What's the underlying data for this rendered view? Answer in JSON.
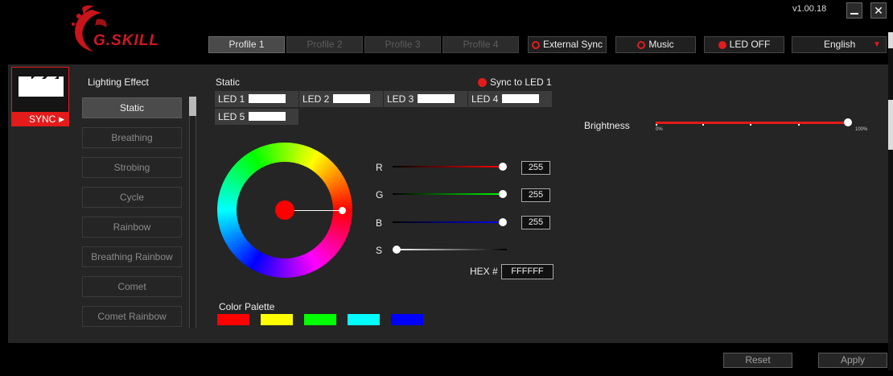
{
  "header": {
    "logo_text": "G.SKILL",
    "version": "v1.00.18",
    "minimize_icon": "minimize-icon",
    "close_icon": "close-icon"
  },
  "profiles": [
    "Profile 1",
    "Profile 2",
    "Profile 3",
    "Profile 4"
  ],
  "toolbar": {
    "external_sync": "External Sync",
    "music": "Music",
    "led_off": "LED OFF",
    "language": "English"
  },
  "sync": {
    "label": "SYNC"
  },
  "effects": {
    "title": "Lighting Effect",
    "items": [
      "Static",
      "Breathing",
      "Strobing",
      "Cycle",
      "Rainbow",
      "Breathing Rainbow",
      "Comet",
      "Comet Rainbow"
    ],
    "selected": "Static"
  },
  "static": {
    "title": "Static",
    "sync_to_led": "Sync to LED 1",
    "leds": [
      "LED 1",
      "LED 2",
      "LED 3",
      "LED 4",
      "LED 5"
    ],
    "led_color": "#FFFFFF"
  },
  "color": {
    "r_label": "R",
    "g_label": "G",
    "b_label": "B",
    "s_label": "S",
    "r": "255",
    "g": "255",
    "b": "255",
    "saturation": 0,
    "hex_label": "HEX #",
    "hex": "FFFFFF",
    "selected_color": "#ff0000"
  },
  "palette": {
    "title": "Color Palette",
    "colors": [
      "#ff0000",
      "#ffff00",
      "#00ff00",
      "#00ffff",
      "#0000ff"
    ]
  },
  "brightness": {
    "label": "Brightness",
    "min_label": "0%",
    "max_label": "100%",
    "value_percent": 100
  },
  "footer": {
    "reset": "Reset",
    "apply": "Apply"
  },
  "colors": {
    "accent": "#e31b1b",
    "panel": "#252525",
    "background": "#000000"
  }
}
